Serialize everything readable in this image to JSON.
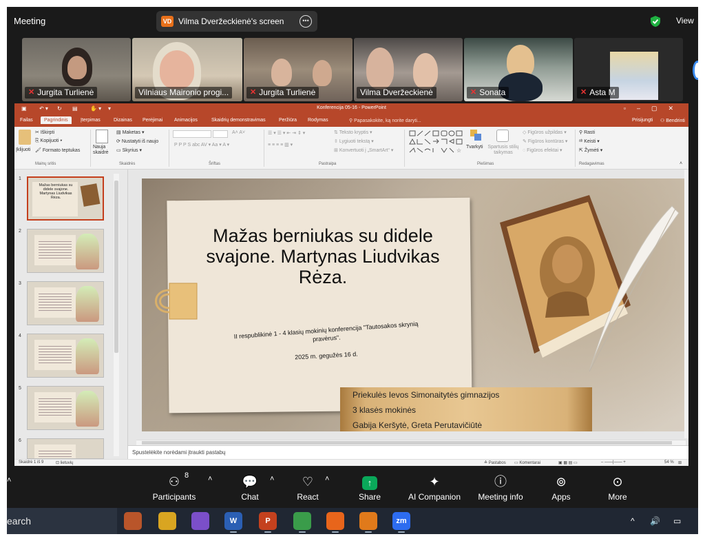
{
  "zoom": {
    "meeting_title": "Meeting",
    "share_initials": "VD",
    "share_label": "Vilma Dveržeckienė's screen",
    "view_label": "View",
    "participants": [
      {
        "name": "Jurgita Turlienė",
        "muted": true
      },
      {
        "name": "Vilniaus Maironio progi...",
        "muted": false,
        "active": true
      },
      {
        "name": "Jurgita Turlienė",
        "muted": true
      },
      {
        "name": "Vilma Dveržeckienė",
        "muted": false
      },
      {
        "name": "Sonata",
        "muted": true
      },
      {
        "name": "Asta M",
        "muted": true
      }
    ],
    "toolbar": {
      "participants_label": "Participants",
      "participants_count": "8",
      "chat_label": "Chat",
      "react_label": "React",
      "share_label": "Share",
      "ai_label": "AI Companion",
      "info_label": "Meeting info",
      "apps_label": "Apps",
      "more_label": "More"
    }
  },
  "ppt": {
    "window_title": "Konferencija 05-16 - PowerPoint",
    "tabs": [
      "Failas",
      "Pagrindinis",
      "Įterpimas",
      "Dizainas",
      "Perėjimai",
      "Animacijos",
      "Skaidrių demonstravimas",
      "Peržiūra",
      "Rodymas"
    ],
    "tell_me": "Papasakokite, ką norite daryti...",
    "sign_in": "Prisijungti",
    "share": "Bendrinti",
    "ribbon": {
      "paste": "Įklijuoti",
      "cut": "Iškirpti",
      "copy": "Kopijuoti",
      "format_painter": "Formato teptukas",
      "clipboard": "Mainų sritis",
      "new_slide": "Nauja skaidrė",
      "layout": "Maketas",
      "reset": "Nustatyti iš naujo",
      "section": "Skyrius",
      "slides": "Skaidrės",
      "font": "Šriftas",
      "text_direction": "Teksto kryptis",
      "align_text": "Lygiuoti tekstą",
      "smartart": "Konvertuoti į „SmartArt“",
      "paragraph": "Pastraipa",
      "arrange": "Tvarkyti",
      "quick_styles": "Spartusis stilių taikymas",
      "shape_fill": "Figūros užpildas",
      "shape_outline": "Figūros kontūras",
      "shape_effects": "Figūros efektai",
      "drawing": "Piešimas",
      "find": "Rasti",
      "replace": "Keisti",
      "select": "Žymėti",
      "editing": "Redagavimas"
    },
    "thumbnails": [
      "1",
      "2",
      "3",
      "4",
      "5",
      "6"
    ],
    "thumb1_title": "Mažas berniukas su didele svajone. Martynas Liudvikas Rėza.",
    "slide": {
      "title": "Mažas berniukas su didele svajone. Martynas Liudvikas Rėza.",
      "subtitle": "II respublikinė 1 - 4 klasių mokinių konferencija \"Tautosakos skrynią pravėrus\".",
      "date": "2025 m. gegužės 16 d.",
      "banner_lines": [
        "Priekulės Ievos Simonaitytės gimnazijos",
        " 3 klasės mokinės",
        "Gabija Keršytė, Greta Perutavičiūtė"
      ]
    },
    "notes_placeholder": "Spustelėkite norėdami įtraukti pastabų",
    "status": {
      "slide_counter": "Skaidrė 1 iš 9",
      "language": "lietuvių",
      "notes": "Pastabos",
      "comments": "Komentarai",
      "zoom": "54 %"
    }
  },
  "taskbar": {
    "search": "earch",
    "apps": [
      {
        "name": "app-orange-icon",
        "glyph": "",
        "color": "#b9552a"
      },
      {
        "name": "file-explorer-icon",
        "glyph": "",
        "color": "#d9a521"
      },
      {
        "name": "visual-studio-icon",
        "glyph": "",
        "color": "#7b4fc9"
      },
      {
        "name": "word-icon",
        "glyph": "W",
        "color": "#2b5fb4"
      },
      {
        "name": "powerpoint-icon",
        "glyph": "P",
        "color": "#c4411e"
      },
      {
        "name": "chrome-icon",
        "glyph": "",
        "color": "#3a9c4a"
      },
      {
        "name": "firefox-icon",
        "glyph": "",
        "color": "#e8651b"
      },
      {
        "name": "app-square-icon",
        "glyph": "",
        "color": "#e07a1b"
      },
      {
        "name": "zoom-app-icon",
        "glyph": "zm",
        "color": "#2d6cf0"
      }
    ],
    "tray_caret": "^"
  }
}
